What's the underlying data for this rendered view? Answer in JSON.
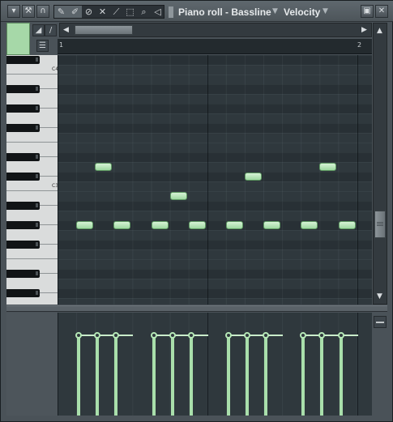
{
  "titlebar": {
    "menu_icon": "triangle-down-icon",
    "title": "Piano roll - Bassline",
    "event_target": "Velocity",
    "window_buttons": {
      "detach": "detach-icon",
      "close": "close-icon"
    }
  },
  "tools": [
    {
      "name": "draw",
      "icon": "pencil-icon",
      "active": true
    },
    {
      "name": "paint",
      "icon": "brush-icon",
      "active": true
    },
    {
      "name": "delete",
      "icon": "delete-icon",
      "active": false
    },
    {
      "name": "mute",
      "icon": "mute-icon",
      "active": false
    },
    {
      "name": "slice",
      "icon": "slice-icon",
      "active": false
    },
    {
      "name": "select",
      "icon": "select-icon",
      "active": false
    },
    {
      "name": "zoom",
      "icon": "zoom-icon",
      "active": false
    },
    {
      "name": "playback",
      "icon": "speaker-icon",
      "active": false
    }
  ],
  "ruler": {
    "bar_1": "1",
    "bar_2": "2"
  },
  "piano": {
    "octave_labels": [
      "C4",
      "C3"
    ]
  },
  "colors": {
    "note_fill": "#a6d8a8",
    "grid_bg": "#2f383d",
    "window_bg": "#4a5258",
    "velocity_bar": "#a9dfab"
  },
  "notes": [
    {
      "step": 1,
      "pitch": "G#2"
    },
    {
      "step": 2,
      "pitch": "D3"
    },
    {
      "step": 3,
      "pitch": "G#2"
    },
    {
      "step": 5,
      "pitch": "G#2"
    },
    {
      "step": 6,
      "pitch": "B2"
    },
    {
      "step": 7,
      "pitch": "G#2"
    },
    {
      "step": 9,
      "pitch": "G#2"
    },
    {
      "step": 10,
      "pitch": "C#3"
    },
    {
      "step": 11,
      "pitch": "G#2"
    },
    {
      "step": 13,
      "pitch": "G#2"
    },
    {
      "step": 14,
      "pitch": "D3"
    },
    {
      "step": 15,
      "pitch": "G#2"
    }
  ],
  "velocities": [
    1,
    1,
    1,
    1,
    1,
    1,
    1,
    1,
    1,
    1,
    1,
    1
  ]
}
